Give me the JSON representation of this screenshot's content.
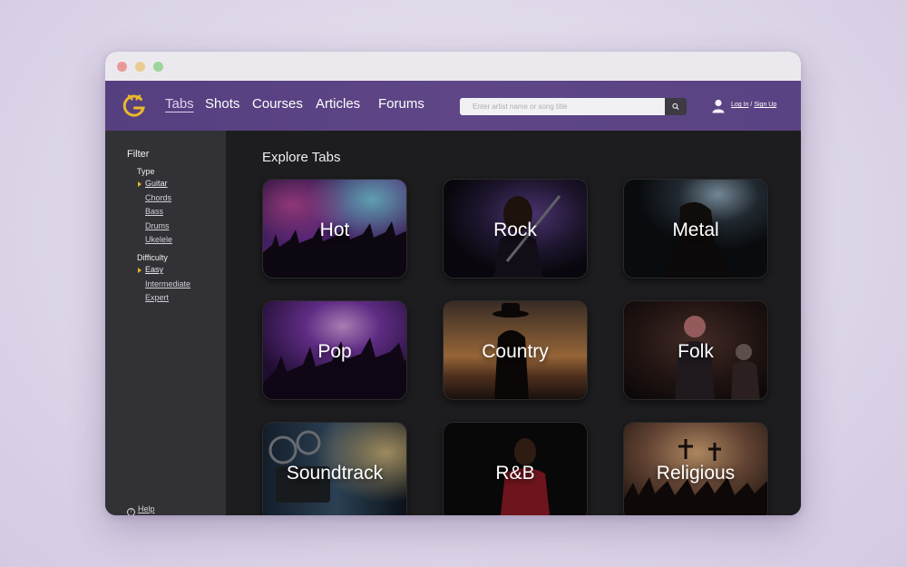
{
  "nav": {
    "links": [
      "Tabs",
      "Shots",
      "Courses",
      "Articles",
      "Forums"
    ],
    "active": "Tabs"
  },
  "search": {
    "placeholder": "Enter artist name or song title"
  },
  "auth": {
    "login": "Log In",
    "separator": "/",
    "signup": "Sign Up"
  },
  "sidebar": {
    "title": "Filter",
    "type_title": "Type",
    "types": [
      "Guitar",
      "Chords",
      "Bass",
      "Drums",
      "Ukelele"
    ],
    "difficulty_title": "Difficulty",
    "difficulties": [
      "Easy",
      "Intermediate",
      "Expert"
    ],
    "help": "Help"
  },
  "main": {
    "title": "Explore Tabs",
    "genres": [
      "Hot",
      "Rock",
      "Metal",
      "Pop",
      "Country",
      "Folk",
      "Soundtrack",
      "R&B",
      "Religious"
    ]
  },
  "colors": {
    "header": "#5a4383",
    "sidebar": "#323236",
    "content": "#1d1d1f",
    "accent": "#e2b327"
  },
  "icons": {
    "logo": "g-guitar-logo-icon",
    "search": "search-icon",
    "user": "user-icon",
    "help": "help-icon"
  }
}
